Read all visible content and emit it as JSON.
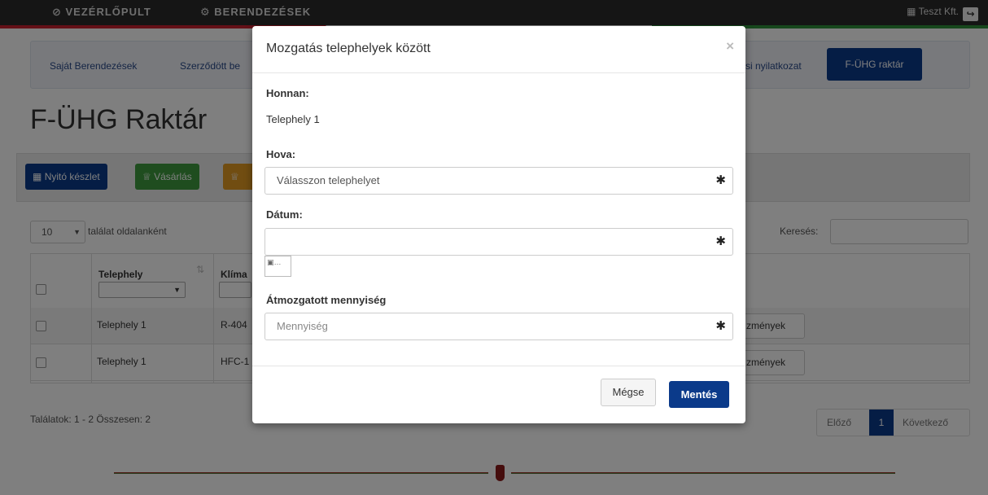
{
  "topbar": {
    "dashboard": "⊘ VEZÉRLŐPULT",
    "equipment": "⚙ BERENDEZÉSEK",
    "company": "Teszt Kft.",
    "logout_icon": "logout-icon"
  },
  "subnav": {
    "own": "Saját Berendezések",
    "contracted": "Szerződött be",
    "declaration": "si nyilatkozat",
    "warehouse": "F-ÜHG raktár"
  },
  "page": {
    "title": "F-ÜHG Raktár"
  },
  "toolbar": {
    "opening": "Nyitó készlet",
    "purchase": "Vásárlás",
    "third_icon": "cart-icon"
  },
  "table_controls": {
    "page_length": "10",
    "per_page_text": "találat oldalanként",
    "search_label": "Keresés:"
  },
  "table": {
    "col_site": "Telephely",
    "col_clima": "Klíma",
    "rows": [
      {
        "site": "Telephely 1",
        "clima": "R-404",
        "events": "zmények"
      },
      {
        "site": "Telephely 1",
        "clima": "HFC-1",
        "events": "zmények"
      }
    ]
  },
  "footer": {
    "results": "Találatok: 1 - 2 Összesen: 2",
    "prev": "Előző",
    "page": "1",
    "next": "Következő"
  },
  "modal": {
    "title": "Mozgatás telephelyek között",
    "close": "×",
    "from_label": "Honnan:",
    "from_value": "Telephely 1",
    "to_label": "Hova:",
    "to_value": "Válasszon telephelyet",
    "date_label": "Dátum:",
    "date_value": "",
    "moved_label": "Átmozgatott mennyiség",
    "quantity_placeholder": "Mennyiség",
    "required_mark": "✱",
    "cancel": "Mégse",
    "save": "Mentés"
  }
}
